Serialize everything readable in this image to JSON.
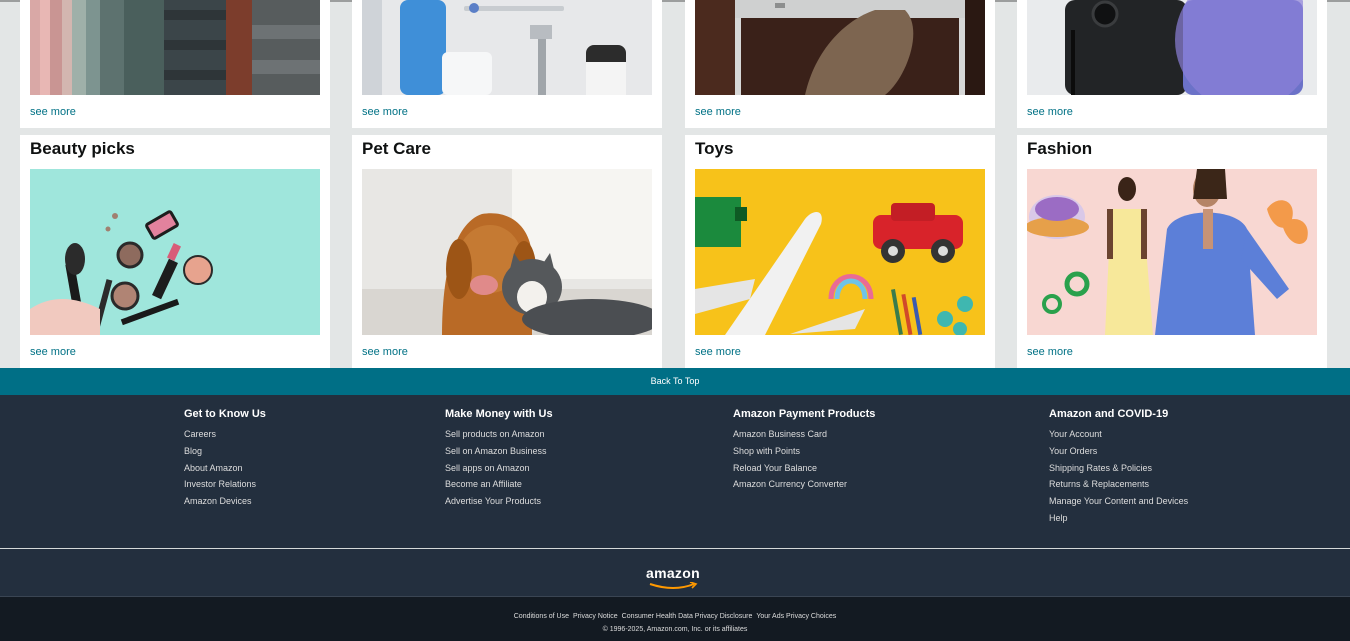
{
  "row1": [
    {
      "see_more": "see more"
    },
    {
      "see_more": "see more"
    },
    {
      "see_more": "see more"
    },
    {
      "see_more": "see more"
    }
  ],
  "row2": [
    {
      "title": "Beauty picks",
      "see_more": "see more"
    },
    {
      "title": "Pet Care",
      "see_more": "see more"
    },
    {
      "title": "Toys",
      "see_more": "see more"
    },
    {
      "title": "Fashion",
      "see_more": "see more"
    }
  ],
  "back_to_top": "Back To Top",
  "footer": {
    "columns": [
      {
        "heading": "Get to Know Us",
        "links": [
          "Careers",
          "Blog",
          "About Amazon",
          "Investor Relations",
          "Amazon Devices"
        ]
      },
      {
        "heading": "Make Money with Us",
        "links": [
          "Sell products on Amazon",
          "Sell on Amazon Business",
          "Sell apps on Amazon",
          "Become an Affiliate",
          "Advertise Your Products"
        ]
      },
      {
        "heading": "Amazon Payment Products",
        "links": [
          "Amazon Business Card",
          "Shop with Points",
          "Reload Your Balance",
          "Amazon Currency Converter"
        ]
      },
      {
        "heading": "Amazon and COVID-19",
        "links": [
          "Your Account",
          "Your Orders",
          "Shipping Rates & Policies",
          "Returns & Replacements",
          "Manage Your Content and Devices",
          "Help"
        ]
      }
    ],
    "logo_text": "amazon",
    "legal_links": [
      "Conditions of Use",
      "Privacy Notice",
      "Consumer Health Data Privacy Disclosure",
      "Your Ads Privacy Choices"
    ],
    "copyright": "© 1996-2025, Amazon.com, Inc. or its affiliates"
  },
  "colors": {
    "teal_bar": "#006f86",
    "footer_bg": "#232f3e",
    "footer_bottom_bg": "#131a22",
    "link": "#007185"
  }
}
